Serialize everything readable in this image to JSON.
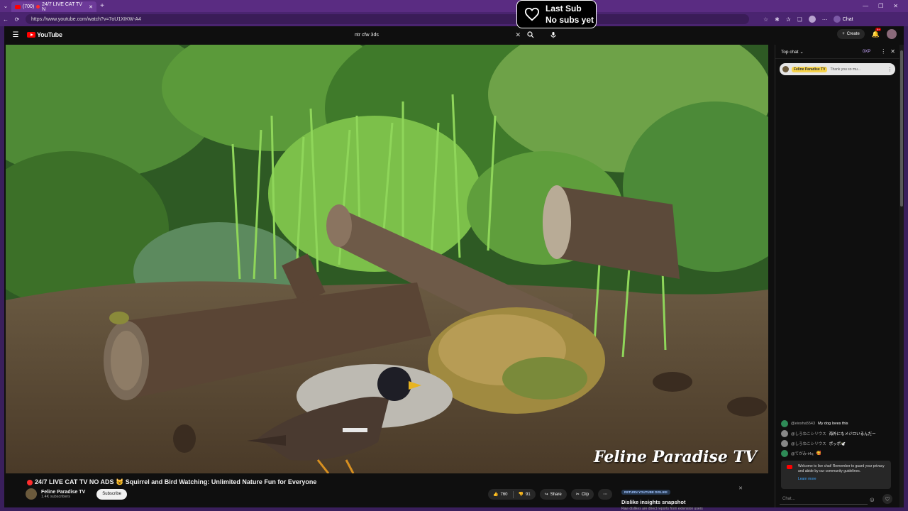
{
  "browser": {
    "tab_count": "(700)",
    "tab_title": "24/7 LIVE CAT TV N",
    "url": "https://www.youtube.com/watch?v=7oU1XIKW-A4",
    "chat_ext_label": "Chat"
  },
  "overlay": {
    "line1": "Last Sub",
    "line2": "No subs yet"
  },
  "youtube": {
    "logo_text": "YouTube",
    "search_value": "ntr cfw 3ds",
    "create_label": "Create",
    "notif_badge": "9+"
  },
  "video": {
    "watermark": "Feline Paradise TV",
    "title": "24/7 LIVE CAT TV NO ADS 😺 Squirrel and Bird Watching: Unlimited Nature Fun for Everyone",
    "channel_name": "Feline Paradise TV",
    "channel_subs": "1.4K subscribers",
    "subscribe_label": "Subscribe",
    "likes": "760",
    "dislikes": "91",
    "share_label": "Share",
    "clip_label": "Clip"
  },
  "dislike_card": {
    "badge": "RETURN YOUTUBE DISLIKE",
    "title": "Dislike insights snapshot",
    "subtitle": "Raw dislikes are direct reports from extension users"
  },
  "chat": {
    "header": "Top chat",
    "xp": "0XP",
    "pinned_name": "Feline Paradise TV",
    "pinned_text": "Thank you so mu...",
    "messages": [
      {
        "author": "@eiosha5543",
        "text": "My dog loves this",
        "color": "#2e8b57"
      },
      {
        "author": "@しろねこシリウス",
        "text": "海外にもメジロいるんだー",
        "color": "#888888"
      },
      {
        "author": "@しろねこシリウス",
        "text": "ポッポ🕊️",
        "color": "#888888"
      },
      {
        "author": "@てがみ-t4q",
        "text": "🥰",
        "color": "#2e8b57"
      }
    ],
    "welcome_text": "Welcome to live chat! Remember to guard your privacy and abide by our community guidelines.",
    "learn_more": "Learn more",
    "input_placeholder": "Chat..."
  }
}
